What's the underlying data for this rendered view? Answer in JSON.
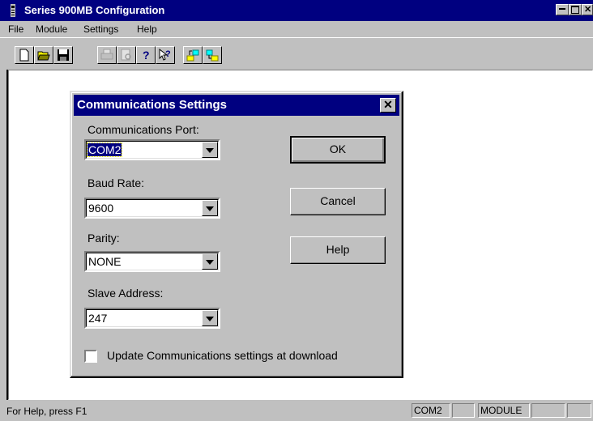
{
  "window": {
    "title": "Series 900MB Configuration",
    "controls": [
      "minimize-icon",
      "maximize-icon",
      "close-icon"
    ]
  },
  "menu": [
    {
      "label": "File"
    },
    {
      "label": "Module"
    },
    {
      "label": "Settings"
    },
    {
      "label": "Help"
    }
  ],
  "toolbar": {
    "buttons": [
      "new-file-icon",
      "open-folder-icon",
      "save-disk-icon",
      "print-icon",
      "print-preview-icon",
      "help-icon",
      "context-help-icon",
      "upload-icon",
      "download-icon"
    ]
  },
  "dialog": {
    "title": "Communications Settings",
    "port_label": "Communications Port:",
    "port_value": "COM2",
    "baud_label": "Baud Rate:",
    "baud_value": "9600",
    "parity_label": "Parity:",
    "parity_value": "NONE",
    "slave_label": "Slave Address:",
    "slave_value": "247",
    "ok_label": "OK",
    "cancel_label": "Cancel",
    "help_label": "Help",
    "checkbox_label": "Update Communications settings at download",
    "checkbox_checked": false
  },
  "status": {
    "help_text": "For Help, press F1",
    "port": "COM2",
    "pane2": "",
    "mode": "MODULE",
    "pane4": "",
    "pane5": ""
  },
  "colors": {
    "title_bar": "#000080",
    "face": "#c0c0c0",
    "client": "#ffffff"
  }
}
